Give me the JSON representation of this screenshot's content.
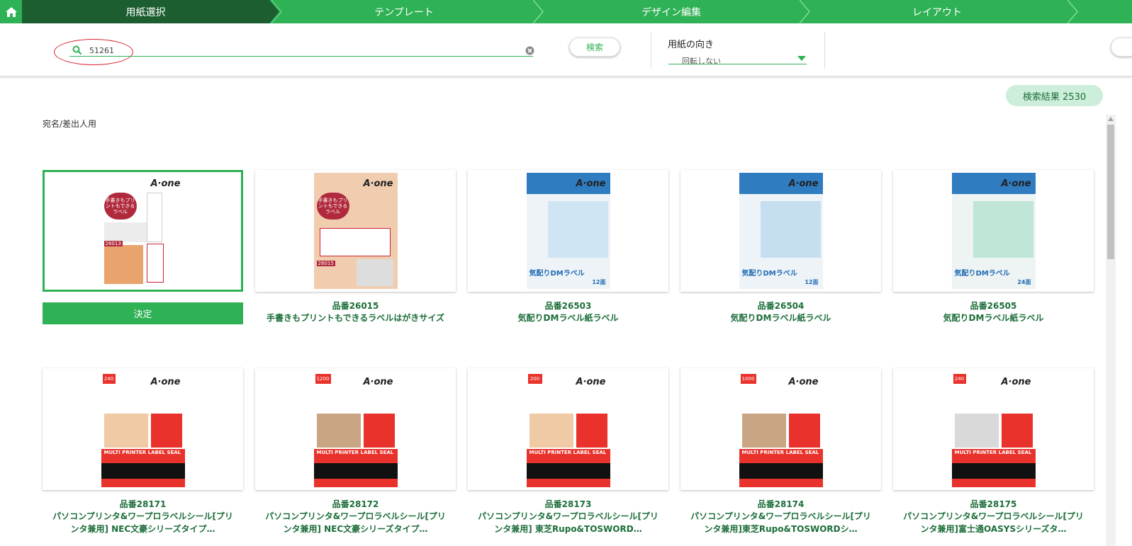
{
  "steps": [
    {
      "label": "用紙選択",
      "active": true
    },
    {
      "label": "テンプレート",
      "active": false
    },
    {
      "label": "デザイン編集",
      "active": false
    },
    {
      "label": "レイアウト",
      "active": false
    }
  ],
  "search": {
    "value": "51261",
    "button_label": "検索"
  },
  "orientation": {
    "label": "用紙の向き",
    "value": "回転しない"
  },
  "results": {
    "count_label": "検索結果 2530"
  },
  "category": "宛名/差出人用",
  "selected_button_label": "決定",
  "brand_logo": "A·one",
  "products": [
    {
      "code": "品番26015",
      "name": "手書きもプリントもできるラベルはがきサイズ",
      "tag": "手書きもプリントもできるラベル",
      "series": "26015"
    },
    {
      "code": "品番26503",
      "name": "気配りDMラベル紙ラベル",
      "tag": "気配りDMラベル",
      "series": "12面"
    },
    {
      "code": "品番26504",
      "name": "気配りDMラベル紙ラベル",
      "tag": "気配りDMラベル",
      "series": "12面"
    },
    {
      "code": "品番26505",
      "name": "気配りDMラベル紙ラベル",
      "tag": "気配りDMラベル",
      "series": "24面"
    },
    {
      "code": "品番28171",
      "name": "パソコンプリンタ&ワープロラベルシール[プリンタ兼用] NEC文豪シリーズタイプ…",
      "tag": "MULTI PRINTER LABEL SEAL",
      "series": "240"
    },
    {
      "code": "品番28172",
      "name": "パソコンプリンタ&ワープロラベルシール[プリンタ兼用] NEC文豪シリーズタイプ…",
      "tag": "MULTI PRINTER LABEL SEAL",
      "series": "1200"
    },
    {
      "code": "品番28173",
      "name": "パソコンプリンタ&ワープロラベルシール[プリンタ兼用] 東芝Rupo&TOSWORD…",
      "tag": "MULTI PRINTER LABEL SEAL",
      "series": "200"
    },
    {
      "code": "品番28174",
      "name": "パソコンプリンタ&ワープロラベルシール[プリンタ兼用]東芝Rupo&TOSWORDシ…",
      "tag": "MULTI PRINTER LABEL SEAL",
      "series": "1000"
    },
    {
      "code": "品番28175",
      "name": "パソコンプリンタ&ワープロラベルシール[プリンタ兼用]富士通OASYSシリーズタ…",
      "tag": "MULTI PRINTER LABEL SEAL",
      "series": "240"
    }
  ],
  "selected_card": {
    "tag": "手書きもプリントもできるラベル",
    "series": "26013"
  }
}
